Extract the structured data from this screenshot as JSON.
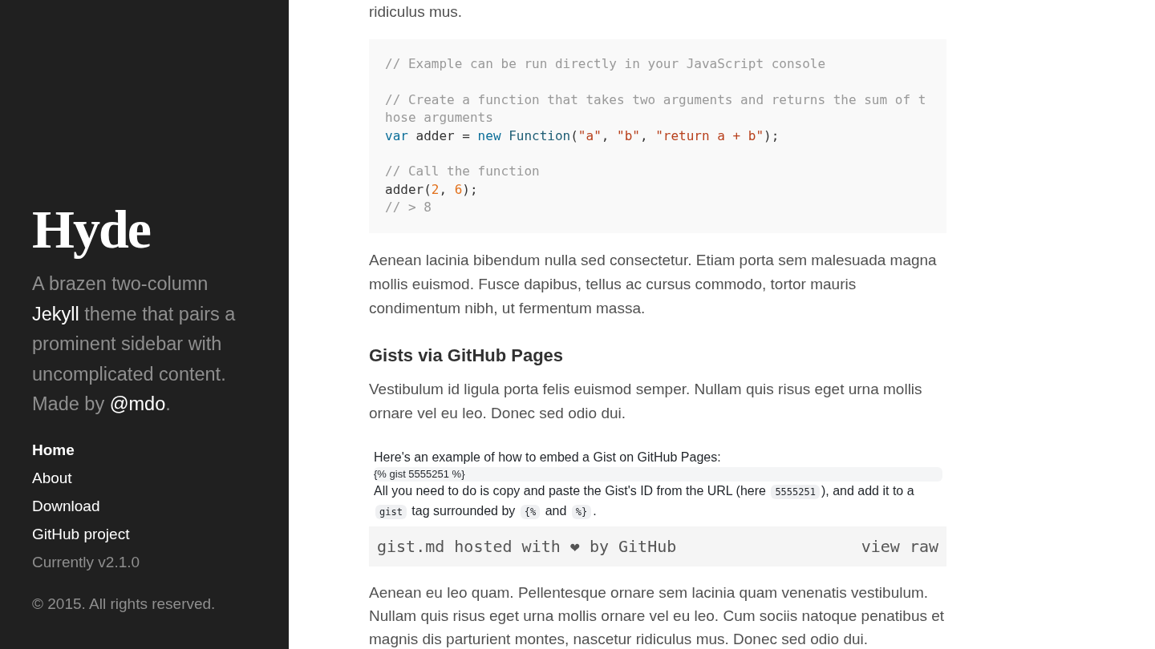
{
  "sidebar": {
    "title": "Hyde",
    "tagline": [
      {
        "kind": "text",
        "text": "A brazen two-column "
      },
      {
        "kind": "link",
        "text": "Jekyll"
      },
      {
        "kind": "text",
        "text": " theme that pairs a prominent sidebar with uncomplicated content. Made by "
      },
      {
        "kind": "link",
        "text": "@mdo"
      },
      {
        "kind": "text",
        "text": "."
      }
    ],
    "nav": [
      {
        "label": "Home",
        "selected": true
      },
      {
        "label": "About",
        "selected": false
      },
      {
        "label": "Download",
        "selected": false
      },
      {
        "label": "GitHub project",
        "selected": false
      }
    ],
    "version": "Currently v2.1.0",
    "copyright": "© 2015. All rights reserved."
  },
  "content": {
    "blocks": [
      {
        "kind": "paragraph",
        "text": "ridiculus mus."
      },
      {
        "kind": "code",
        "sections": [
          {
            "lines": [
              {
                "tokens": [
                  {
                    "kind": "comment",
                    "text": "// Example can be run directly in your JavaScript console"
                  }
                ]
              }
            ]
          },
          {
            "lines": [
              {
                "tokens": [
                  {
                    "kind": "comment",
                    "text": "// Create a function that takes two arguments and returns the sum of those arguments"
                  }
                ]
              },
              {
                "tokens": [
                  {
                    "kind": "keyword",
                    "text": "var"
                  },
                  {
                    "kind": "plain",
                    "text": " adder = "
                  },
                  {
                    "kind": "keyword",
                    "text": "new"
                  },
                  {
                    "kind": "builtin",
                    "text": " Function"
                  },
                  {
                    "kind": "plain",
                    "text": "("
                  },
                  {
                    "kind": "string",
                    "text": "\"a\""
                  },
                  {
                    "kind": "plain",
                    "text": ", "
                  },
                  {
                    "kind": "string",
                    "text": "\"b\""
                  },
                  {
                    "kind": "plain",
                    "text": ", "
                  },
                  {
                    "kind": "string",
                    "text": "\"return a + b\""
                  },
                  {
                    "kind": "plain",
                    "text": ");"
                  }
                ]
              }
            ]
          },
          {
            "lines": [
              {
                "tokens": [
                  {
                    "kind": "comment",
                    "text": "// Call the function"
                  }
                ]
              },
              {
                "tokens": [
                  {
                    "kind": "plain",
                    "text": "adder("
                  },
                  {
                    "kind": "number",
                    "text": "2"
                  },
                  {
                    "kind": "plain",
                    "text": ", "
                  },
                  {
                    "kind": "number",
                    "text": "6"
                  },
                  {
                    "kind": "plain",
                    "text": ");"
                  }
                ]
              },
              {
                "tokens": [
                  {
                    "kind": "comment",
                    "text": "// > 8"
                  }
                ]
              }
            ]
          }
        ]
      },
      {
        "kind": "paragraph",
        "text": "Aenean lacinia bibendum nulla sed consectetur. Etiam porta sem malesuada magna mollis euismod. Fusce dapibus, tellus ac cursus commodo, tortor mauris condimentum nibh, ut fermentum massa."
      },
      {
        "kind": "heading",
        "text": "Gists via GitHub Pages"
      },
      {
        "kind": "paragraph",
        "text": "Vestibulum id ligula porta felis euismod semper. Nullam quis risus eget urna mollis ornare vel eu leo. Donec sed odio dui."
      },
      {
        "kind": "gist",
        "intro": "Here's an example of how to embed a Gist on GitHub Pages:",
        "tag": "{% gist 5555251 %}",
        "body": [
          {
            "kind": "text",
            "text": "All you need to do is copy and paste the Gist's ID from the URL (here "
          },
          {
            "kind": "code",
            "text": "5555251"
          },
          {
            "kind": "text",
            "text": "), and add it to a "
          },
          {
            "kind": "code",
            "text": "gist"
          },
          {
            "kind": "text",
            "text": " tag surrounded by "
          },
          {
            "kind": "code",
            "text": "{%"
          },
          {
            "kind": "text",
            "text": " and "
          },
          {
            "kind": "code",
            "text": "%}"
          },
          {
            "kind": "text",
            "text": "."
          }
        ],
        "footer": {
          "meta": "gist.md hosted with ❤ by GitHub",
          "action": "view raw"
        }
      },
      {
        "kind": "paragraph",
        "text": "Aenean eu leo quam. Pellentesque ornare sem lacinia quam venenatis vestibulum. Nullam quis risus eget urna mollis ornare vel eu leo. Cum sociis natoque penatibus et magnis dis parturient montes, nascetur ridiculus mus. Donec sed odio dui."
      }
    ]
  }
}
